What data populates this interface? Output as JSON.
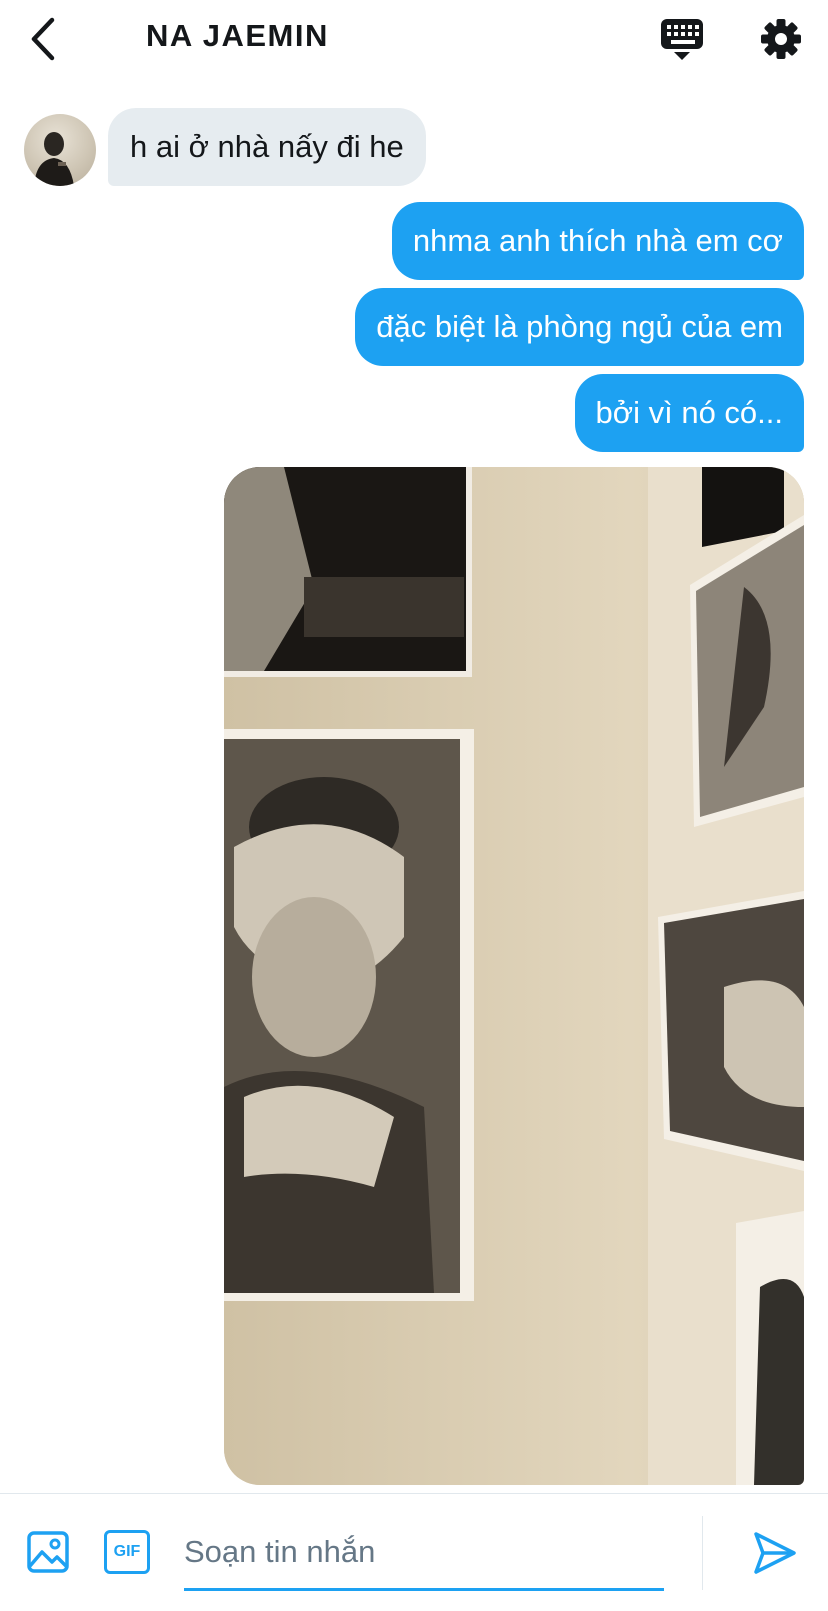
{
  "header": {
    "title": "NA JAEMIN"
  },
  "messages": [
    {
      "direction": "incoming",
      "text": "h ai ở nhà nấy đi he"
    },
    {
      "direction": "outgoing",
      "text": "nhma anh thích nhà em cơ"
    },
    {
      "direction": "outgoing",
      "text": "đặc biệt là phòng ngủ của em"
    },
    {
      "direction": "outgoing",
      "text": "bởi vì nó có..."
    }
  ],
  "composer": {
    "gif_label": "GIF",
    "placeholder": "Soạn tin nhắn",
    "value": ""
  },
  "icons": {
    "back": "chevron-left-icon",
    "keyboard": "keyboard-icon",
    "settings": "gear-icon",
    "image": "image-icon",
    "send": "send-icon"
  },
  "colors": {
    "accent": "#1da1f2",
    "incoming_bubble": "#e6ecf0",
    "text": "#14171a",
    "placeholder": "#657786"
  }
}
